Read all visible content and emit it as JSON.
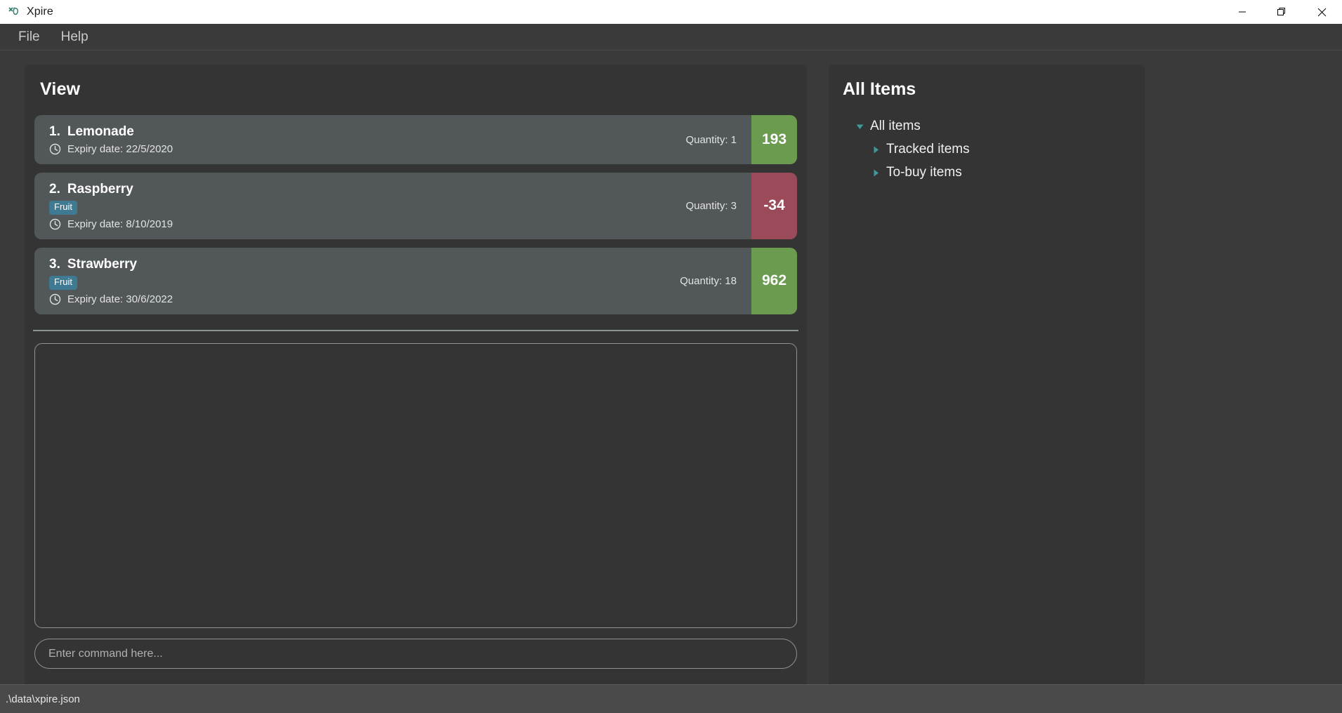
{
  "window": {
    "title": "Xpire",
    "logo_icon": "xpire-leaf-icon",
    "controls": {
      "minimize": "minimize-icon",
      "restore": "restore-icon",
      "close": "close-icon"
    }
  },
  "menubar": {
    "items": [
      {
        "label": "File"
      },
      {
        "label": "Help"
      }
    ]
  },
  "view_panel": {
    "title": "View",
    "items": [
      {
        "index": "1.",
        "name": "Lemonade",
        "tags": [],
        "expiry_icon": "clock-icon",
        "expiry": "Expiry date: 22/5/2020",
        "quantity": "Quantity: 1",
        "badge_value": "193",
        "badge_state": "green"
      },
      {
        "index": "2.",
        "name": "Raspberry",
        "tags": [
          "Fruit"
        ],
        "expiry_icon": "clock-icon",
        "expiry": "Expiry date: 8/10/2019",
        "quantity": "Quantity: 3",
        "badge_value": "-34",
        "badge_state": "red"
      },
      {
        "index": "3.",
        "name": "Strawberry",
        "tags": [
          "Fruit"
        ],
        "expiry_icon": "clock-icon",
        "expiry": "Expiry date: 30/6/2022",
        "quantity": "Quantity: 18",
        "badge_value": "962",
        "badge_state": "green"
      }
    ],
    "result_box_text": "",
    "command_input": {
      "value": "",
      "placeholder": "Enter command here..."
    }
  },
  "side_panel": {
    "title": "All Items",
    "tree": [
      {
        "label": "All items",
        "level": 0,
        "expanded": true,
        "icon": "triangle-down-icon"
      },
      {
        "label": "Tracked items",
        "level": 1,
        "expanded": false,
        "icon": "triangle-right-icon"
      },
      {
        "label": "To-buy items",
        "level": 1,
        "expanded": false,
        "icon": "triangle-right-icon"
      }
    ]
  },
  "statusbar": {
    "path": ".\\data\\xpire.json"
  },
  "colors": {
    "window_bg": "#3a3a3a",
    "panel_bg": "#343434",
    "card_bg": "#52575a",
    "tag_bg": "#3f7a93",
    "badge_green": "#6b9b4e",
    "badge_red": "#9b4a5a",
    "tree_accent": "#3f9a9a",
    "titlebar_bg": "#ffffff",
    "statusbar_bg": "#4a4a4a"
  }
}
